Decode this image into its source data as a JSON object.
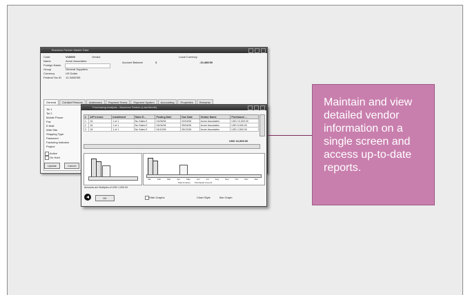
{
  "callout_text": "Maintain and view detailed vendor information on a single screen and access up-to-date reports.",
  "bp_window": {
    "title": "Business Partner Master Data",
    "fields": {
      "code_label": "Code",
      "code_value": "V10000",
      "type_value": "Vendor",
      "name_label": "Name",
      "name_value": "Acme Associates",
      "foreign_name_label": "Foreign Name",
      "group_label": "Group",
      "group_value": "General Suppliers",
      "currency_label": "Currency",
      "currency_value": "US Dollar",
      "federal_tax_label": "Federal Tax ID",
      "federal_tax_value": "12-3456789",
      "local_currency_label": "Local Currency",
      "account_balance_label": "Account Balance",
      "account_balance_currency": "$",
      "account_balance_value": "-10,488.50"
    },
    "tabs": [
      "General",
      "Contact Persons",
      "Addresses",
      "Payment Terms",
      "Payment System",
      "Accounting",
      "Properties",
      "Remarks"
    ],
    "general": {
      "tel1_label": "Tel 1",
      "tel1_value": "800-555-0100",
      "tel2_label": "Tel 2",
      "mobile_label": "Mobile Phone",
      "mobile_value": "555-555-0123",
      "fax_label": "Fax",
      "fax_value": "555-555-0124",
      "email_label": "E-Mail",
      "website_label": "Web Site",
      "shipping_label": "Shipping Type",
      "password_label": "Password",
      "factoring_label": "Factoring Indicator",
      "project_label": "Project",
      "contact_person_label": "Contact Person",
      "contact_person_value": "Mark Killingsworth",
      "id_label": "ID No. 2",
      "active_label": "Active",
      "on_hold_label": "On Hold"
    },
    "buttons": {
      "update": "Update",
      "cancel": "Cancel"
    }
  },
  "pa_window": {
    "title": "Purchasing Analysis - Business Partner (Last Month)",
    "columns": [
      "#",
      "A/P Invoice",
      "Installment",
      "Sales E...",
      "Posting Date",
      "Due Date",
      "Vendor Name",
      "Purchased ..."
    ],
    "rows": [
      [
        "1",
        "15",
        "1 of 1",
        "No Sales E",
        "01/05/06",
        "02/04/06",
        "Acme Associates",
        "USD 10,000.00"
      ],
      [
        "2",
        "16",
        "1 of 1",
        "No Sales E",
        "04/04/06",
        "05/04/06",
        "Acme Associates",
        "USD 5,000.00"
      ],
      [
        "3",
        "18",
        "1 of 1",
        "No Sales E",
        "04/12/06",
        "05/12/06",
        "Acme Associates",
        "USD 2,500.00"
      ]
    ],
    "total_value": "USD 16,500.00",
    "amounts_note": "Amounts are Multiples of USD 1,000.00",
    "legend": {
      "paid": "Paid Invoices",
      "purchased": "Purchased Amount"
    },
    "month_labels": [
      "Jan",
      "Feb",
      "Mar",
      "Apr",
      "May",
      "Jun",
      "Jul",
      "Aug",
      "Sep",
      "Oct",
      "Nov",
      "Dec"
    ],
    "ok_label": "OK",
    "hide_graphs_label": "Hide Graphs",
    "chart_style_label": "Chart Style",
    "chart_style_value": "Bar Graph"
  }
}
